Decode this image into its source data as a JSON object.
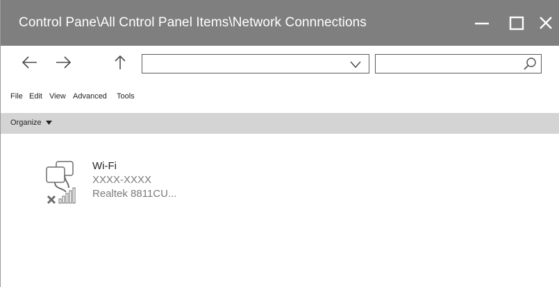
{
  "window": {
    "title": "Control Pane\\All Cntrol Panel Items\\Network Connnections"
  },
  "nav": {
    "back_icon": "arrow-left",
    "forward_icon": "arrow-right",
    "up_icon": "arrow-up",
    "address_value": "",
    "search_placeholder": ""
  },
  "menu": {
    "items": [
      {
        "label": "File"
      },
      {
        "label": "Edit"
      },
      {
        "label": "View"
      },
      {
        "label": "Advanced"
      },
      {
        "label": "Tools"
      }
    ]
  },
  "commandbar": {
    "organize_label": "Organize"
  },
  "connections": [
    {
      "name": "Wi-Fi",
      "status": "XXXX-XXXX",
      "device": "Realtek 8811CU...",
      "icon": "wireless-network-disconnected-icon"
    }
  ],
  "colors": {
    "titlebar": "#7f7f7f",
    "commandbar": "#d4d4d4",
    "disconnected_x": "#6b6b6b"
  }
}
